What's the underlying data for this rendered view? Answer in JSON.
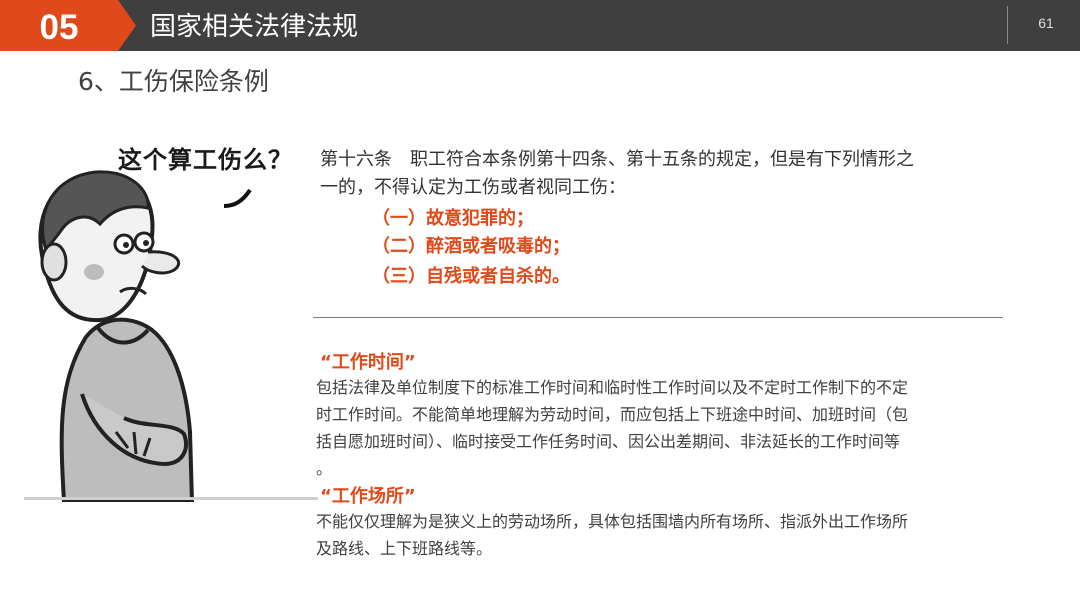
{
  "header": {
    "section_number": "05",
    "section_title": "国家相关法律法规",
    "page_number": "61",
    "colors": {
      "bar": "#3f3f3f",
      "badge": "#e04a1a"
    }
  },
  "subtitle": "6、工伤保险条例",
  "illustration": {
    "caption": "这个算工伤么？",
    "icon": "confused-worker-illustration"
  },
  "article": {
    "line1": "第十六条　职工符合本条例第十四条、第十五条的规定，但是有下列情形之",
    "line2": "一的，不得认定为工伤或者视同工伤：",
    "items": [
      "（一）故意犯罪的；",
      "（二）醉酒或者吸毒的；",
      "（三）自残或者自杀的。"
    ],
    "accent_color": "#e04a1a"
  },
  "definitions": [
    {
      "title": "“工作时间”",
      "lines": [
        "包括法律及单位制度下的标准工作时间和临时性工作时间以及不定时工作制下的不定",
        "时工作时间。不能简单地理解为劳动时间，而应包括上下班途中时间、加班时间（包",
        "括自愿加班时间）、临时接受工作任务时间、因公出差期间、非法延长的工作时间等",
        "。"
      ]
    },
    {
      "title": "“工作场所”",
      "lines": [
        "不能仅仅理解为是狭义上的劳动场所，具体包括围墙内所有场所、指派外出工作场所",
        "及路线、上下班路线等。"
      ]
    }
  ]
}
